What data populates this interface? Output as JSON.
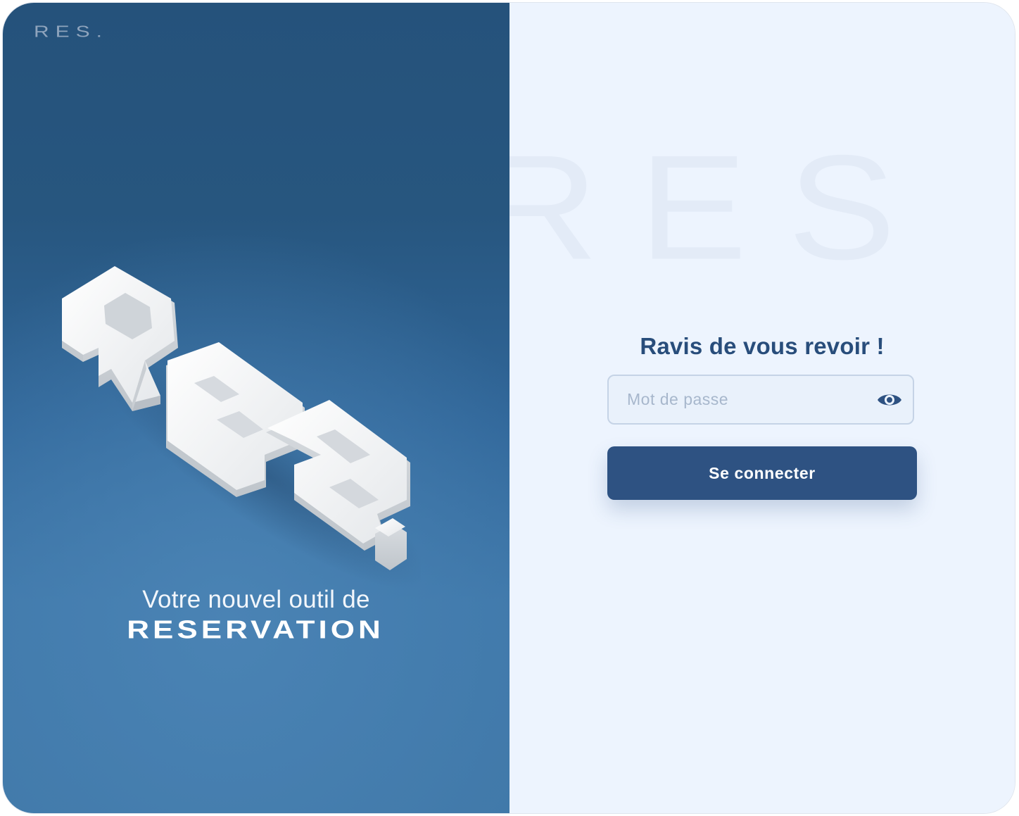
{
  "brand": {
    "logo_text": "RES.",
    "watermark_text": "RES"
  },
  "hero": {
    "art_name": "3d-res-logo",
    "tagline_line1": "Votre nouvel outil de",
    "tagline_line2": "RESERVATION"
  },
  "login": {
    "heading": "Ravis de vous revoir !",
    "password": {
      "placeholder": "Mot de passe",
      "value": "",
      "toggle_icon": "eye-icon"
    },
    "submit_label": "Se connecter"
  },
  "colors": {
    "brand_dark": "#2e5282",
    "left_panel_top": "#25527b",
    "left_panel_bottom": "#4078a8",
    "right_panel_bg": "#edf4fe",
    "heading_text": "#284d7b"
  }
}
